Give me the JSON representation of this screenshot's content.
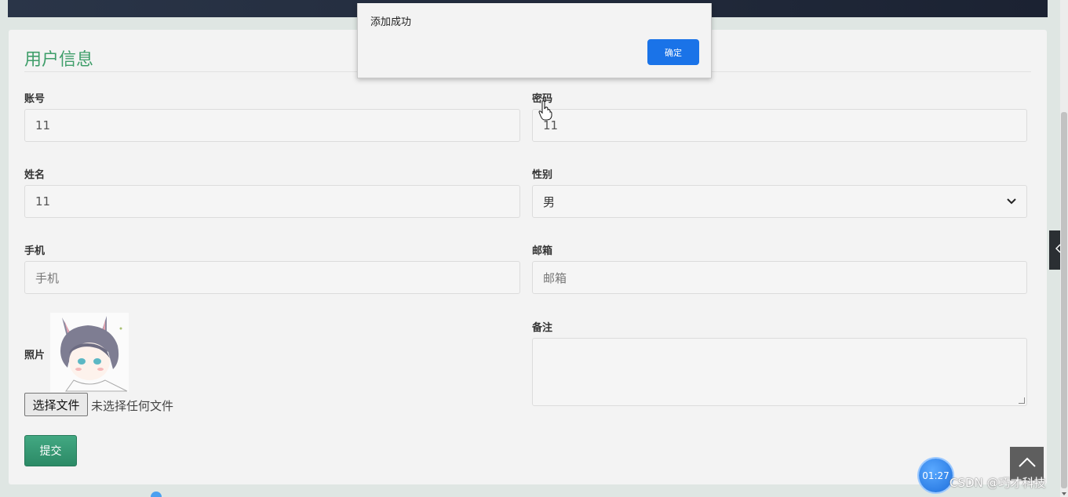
{
  "dialog": {
    "message": "添加成功",
    "ok_label": "确定"
  },
  "form": {
    "title": "用户信息",
    "account": {
      "label": "账号",
      "value": "11"
    },
    "password": {
      "label": "密码",
      "value": "11"
    },
    "name": {
      "label": "姓名",
      "value": "11"
    },
    "gender": {
      "label": "性别",
      "selected": "男"
    },
    "phone": {
      "label": "手机",
      "placeholder": "手机"
    },
    "email": {
      "label": "邮箱",
      "placeholder": "邮箱"
    },
    "photo": {
      "label": "照片",
      "choose_label": "选择文件",
      "status": "未选择任何文件"
    },
    "remark": {
      "label": "备注"
    },
    "submit_label": "提交"
  },
  "overlay": {
    "timer": "01:27",
    "watermark": "CSDN @巧才科技"
  },
  "colors": {
    "accent_green": "#3f9e6a",
    "dialog_button_blue": "#1a73e8",
    "submit_green": "#2c8a66"
  }
}
